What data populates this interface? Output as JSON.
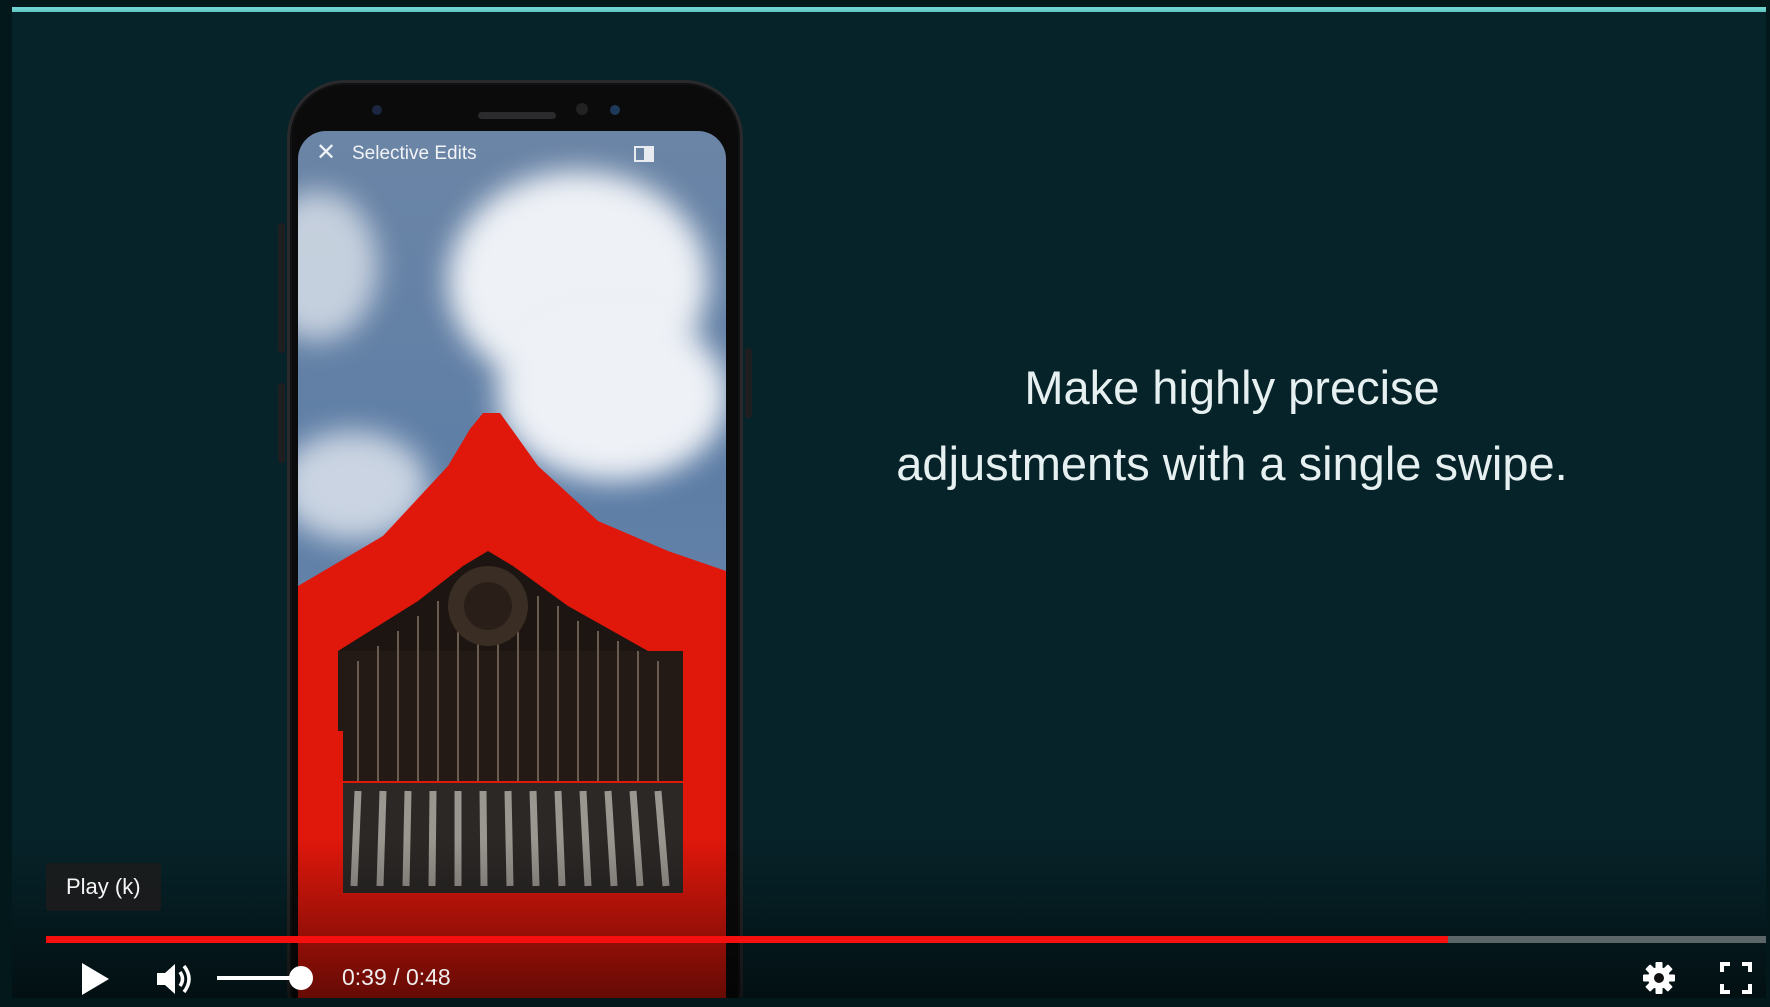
{
  "phone": {
    "screen_title": "Selective Edits",
    "close_icon": "close-icon",
    "compare_icon": "compare-icon",
    "overlay_color": "#e0170b"
  },
  "headline": {
    "line1": "Make highly precise",
    "line2": "adjustments with a single swipe."
  },
  "player": {
    "tooltip": "Play (k)",
    "time_current": "0:39",
    "time_separator": " / ",
    "time_total": "0:48",
    "progress_fraction": 0.8125,
    "volume_fraction": 0.88,
    "icons": {
      "play": "play-icon",
      "volume": "volume-icon",
      "settings": "gear-icon",
      "fullscreen": "fullscreen-icon"
    },
    "accent": "#f50f0f"
  }
}
